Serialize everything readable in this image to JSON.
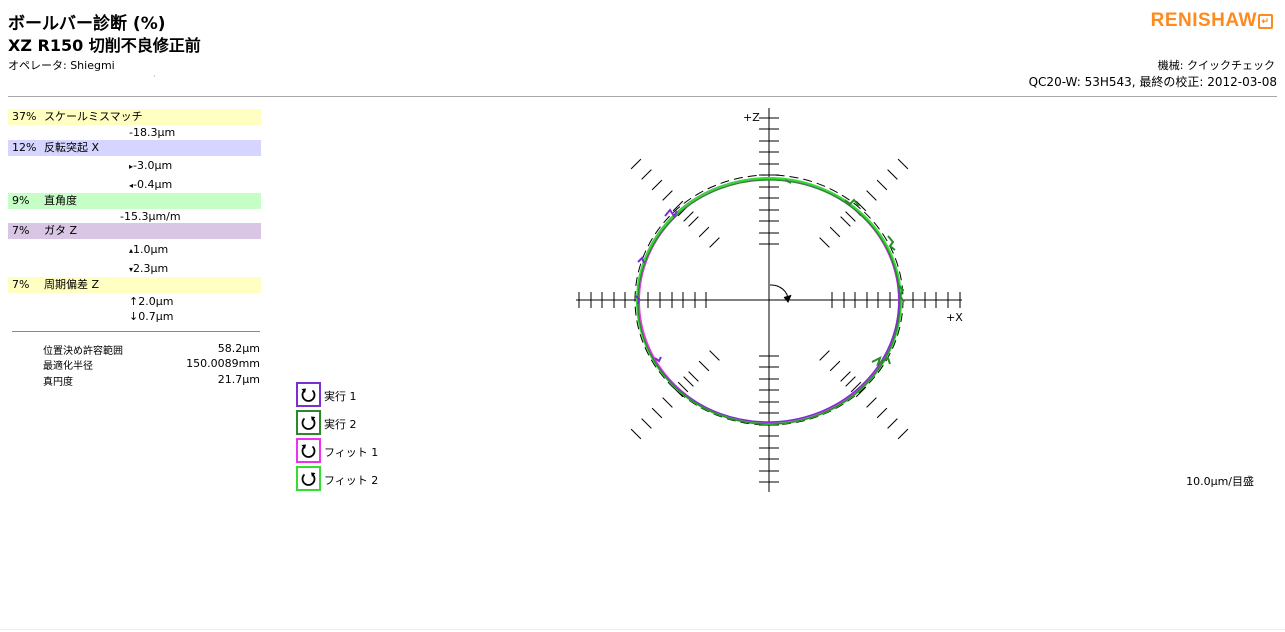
{
  "header": {
    "title": "ボールバー診断 (%)",
    "subtitle": "XZ  R150  切削不良修正前",
    "operator": "オペレータ: Shiegmi",
    "logo": "RENISHAW",
    "machine": "機械: クイックチェック",
    "device_calibration": "QC20-W: 53H543, 最終の校正: 2012-03-08"
  },
  "errors": [
    {
      "pct": "37%",
      "name": "スケールミスマッチ",
      "color": "#ffffc2",
      "values": [
        {
          "prefix": "",
          "text": "-18.3µm"
        }
      ]
    },
    {
      "pct": "12%",
      "name": "反転突起 X",
      "color": "#d5d5ff",
      "values": [
        {
          "prefix": "▸",
          "text": "-3.0µm"
        },
        {
          "prefix": "◂",
          "text": "-0.4µm"
        }
      ]
    },
    {
      "pct": "9%",
      "name": "直角度",
      "color": "#c5ffc5",
      "values": [
        {
          "prefix": "",
          "text": "-15.3µm/m"
        }
      ]
    },
    {
      "pct": "7%",
      "name": "ガタ Z",
      "color": "#d9c5e4",
      "values": [
        {
          "prefix": "▴",
          "text": "1.0µm"
        },
        {
          "prefix": "▾",
          "text": "2.3µm"
        }
      ]
    },
    {
      "pct": "7%",
      "name": "周期偏差 Z",
      "color": "#ffffc2",
      "values": [
        {
          "prefix": "↑",
          "text": "2.0µm"
        },
        {
          "prefix": "↓",
          "text": "0.7µm"
        }
      ]
    }
  ],
  "stats": [
    {
      "label": "位置決め許容範囲",
      "value": "58.2µm"
    },
    {
      "label": "最適化半径",
      "value": "150.0089mm"
    },
    {
      "label": "真円度",
      "value": "21.7µm"
    }
  ],
  "legend": [
    {
      "label": "実行 1",
      "color": "#7b2fd1",
      "icon": "ccw-arrow-icon"
    },
    {
      "label": "実行 2",
      "color": "#2a8a2a",
      "icon": "cw-arrow-icon"
    },
    {
      "label": "フィット 1",
      "color": "#ee33ee",
      "icon": "ccw-arrow-icon"
    },
    {
      "label": "フィット 2",
      "color": "#33dd33",
      "icon": "cw-arrow-icon"
    }
  ],
  "plot": {
    "x_axis_label": "+X",
    "z_axis_label": "+Z",
    "scale": "10.0µm/目盛"
  },
  "colors": {
    "logo": "#ff8a1f",
    "run1": "#7b2fd1",
    "run2": "#2a8a2a",
    "fit1": "#ee33ee",
    "fit2": "#33dd33"
  }
}
